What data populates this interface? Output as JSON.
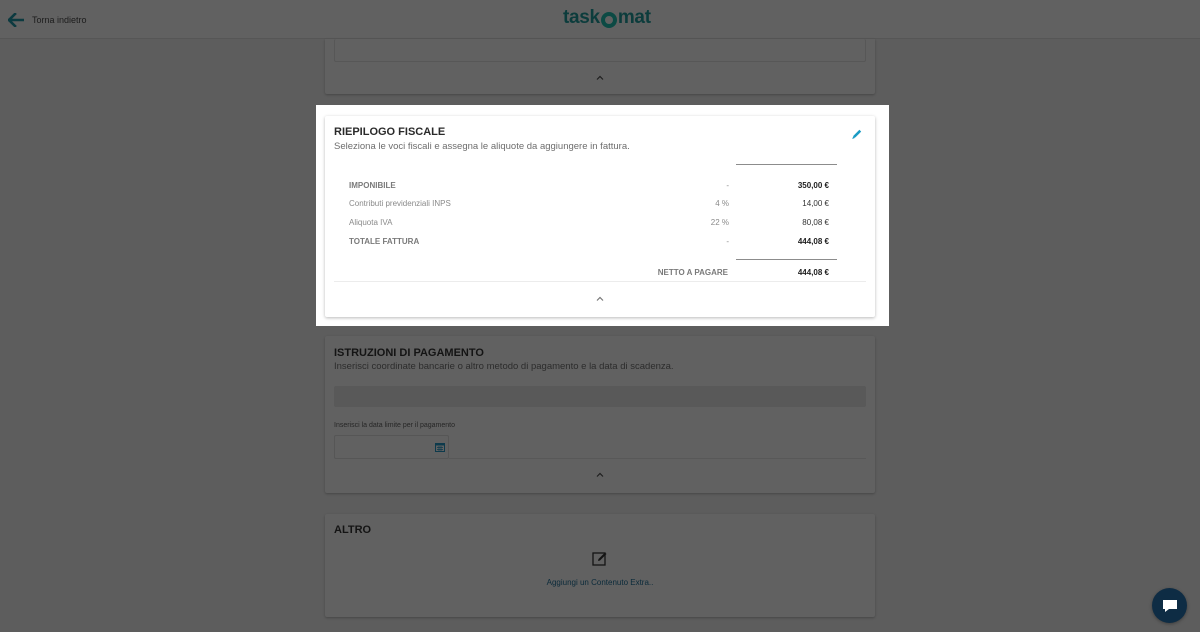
{
  "header": {
    "back_label": "Torna indietro",
    "logo_text_left": "task",
    "logo_text_right": "mat"
  },
  "fiscal": {
    "title": "RIEPILOGO FISCALE",
    "subtitle": "Seleziona le voci fiscali e assegna le aliquote da aggiungere in fattura.",
    "rows": [
      {
        "label": "IMPONIBILE",
        "rate": "-",
        "value": "350,00 €",
        "bold": true
      },
      {
        "label": "Contributi previdenziali INPS",
        "rate": "4 %",
        "value": "14,00 €",
        "bold": false
      },
      {
        "label": "Aliquota IVA",
        "rate": "22 %",
        "value": "80,08 €",
        "bold": false
      },
      {
        "label": "TOTALE FATTURA",
        "rate": "-",
        "value": "444,08 €",
        "bold": true
      }
    ],
    "net_label": "NETTO A PAGARE",
    "net_value": "444,08 €"
  },
  "payment": {
    "title": "ISTRUZIONI DI PAGAMENTO",
    "subtitle": "Inserisci coordinate bancarie o altro metodo di pagamento e la data di scadenza.",
    "date_label": "Inserisci la data limite per il pagamento",
    "date_value": ""
  },
  "other": {
    "title": "ALTRO",
    "add_extra_label": "Aggiungi un Contenuto Extra.."
  },
  "colors": {
    "accent": "#1a9bc4",
    "overlay": "#5d5d5d",
    "chat_button": "#0e2c44"
  }
}
